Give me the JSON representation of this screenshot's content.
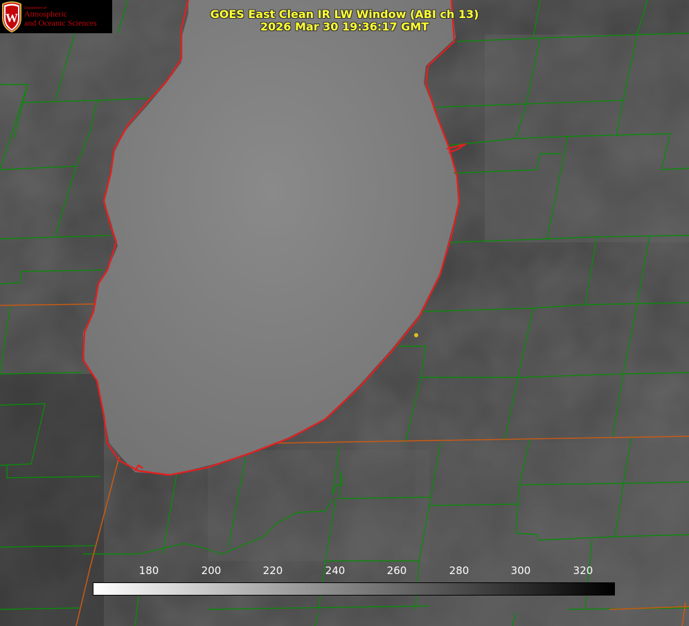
{
  "header": {
    "title_line1": "GOES East Clean IR LW Window (ABI ch 13)",
    "title_line2": "2026 Mar 30 19:36:17 GMT"
  },
  "logo": {
    "department": "Department of",
    "name_line1": "Atmospheric",
    "name_line2": "and Oceanic Sciences",
    "crest_letter": "W",
    "crest_color": "#c5050c"
  },
  "colorbar": {
    "ticks": [
      "180",
      "200",
      "220",
      "240",
      "260",
      "280",
      "300",
      "320"
    ],
    "gradient_from": "#ffffff",
    "gradient_to": "#000000"
  },
  "colors": {
    "county_lines": "#0b8a0b",
    "state_lines": "#c85a14",
    "coastline": "#e02020",
    "marker": "#e0c020",
    "lake_fill": "#7a7a7a",
    "land_fill": "#4a4a4a"
  }
}
